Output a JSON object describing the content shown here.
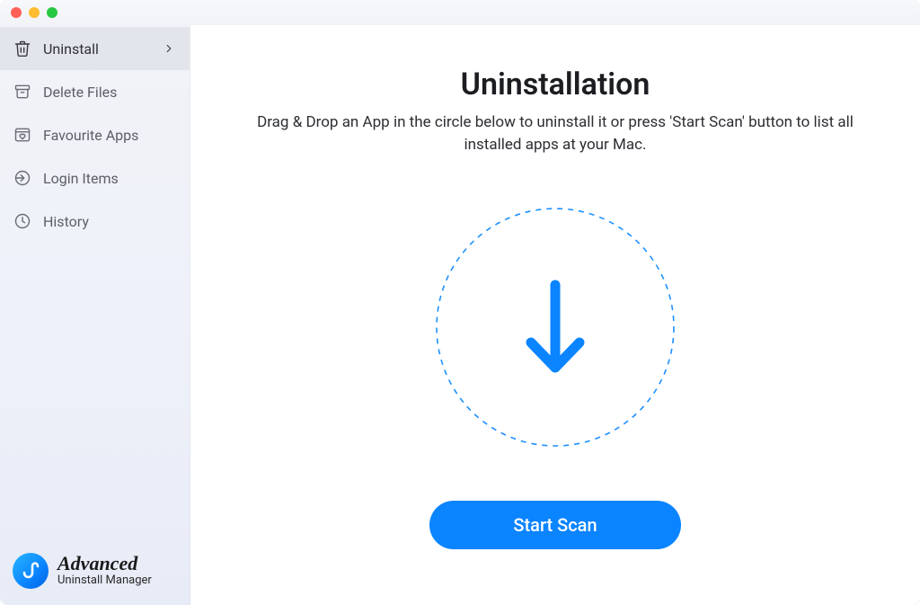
{
  "sidebar": {
    "items": [
      {
        "label": "Uninstall",
        "icon": "trash-icon",
        "active": true,
        "has_chevron": true
      },
      {
        "label": "Delete Files",
        "icon": "archive-icon",
        "active": false,
        "has_chevron": false
      },
      {
        "label": "Favourite Apps",
        "icon": "heart-box-icon",
        "active": false,
        "has_chevron": false
      },
      {
        "label": "Login Items",
        "icon": "login-arrow-icon",
        "active": false,
        "has_chevron": false
      },
      {
        "label": "History",
        "icon": "clock-icon",
        "active": false,
        "has_chevron": false
      }
    ]
  },
  "brand": {
    "line1": "Advanced",
    "line2": "Uninstall Manager"
  },
  "main": {
    "title": "Uninstallation",
    "subtitle": "Drag & Drop an App in the circle below to uninstall it or press 'Start Scan' button to list all installed apps at your Mac.",
    "start_scan_label": "Start Scan"
  },
  "colors": {
    "accent": "#0a84ff",
    "dashed_ring": "#1e90ff"
  }
}
